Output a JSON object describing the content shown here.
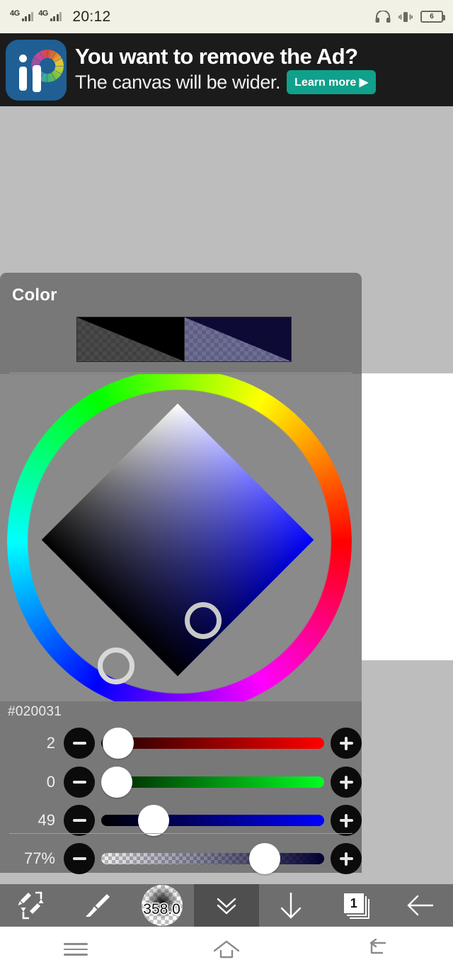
{
  "status_bar": {
    "network_1": "4G",
    "network_2": "4G",
    "time": "20:12",
    "headphones_icon": "headphones-icon",
    "vibrate_icon": "vibrate-icon",
    "battery_level": "6"
  },
  "ad": {
    "headline": "You want to remove the Ad?",
    "subline": "The canvas will be wider.",
    "cta_label": "Learn more ▶",
    "logo_name": "ibis-paint-logo",
    "background_color": "#1b1b1b",
    "cta_color": "#10a08b"
  },
  "color_panel": {
    "title": "Color",
    "previous_swatch_color": "#000000",
    "current_swatch_color": "#020031",
    "next_top_label": "›",
    "next_bottom_label": "›",
    "hex_value": "#020031",
    "sliders": [
      {
        "name": "red",
        "value": "2",
        "percent": 0.8,
        "track": "red-gradient"
      },
      {
        "name": "green",
        "value": "0",
        "percent": 0.0,
        "track": "green-gradient"
      },
      {
        "name": "blue",
        "value": "49",
        "percent": 19.2,
        "track": "blue-gradient"
      },
      {
        "name": "alpha",
        "value": "77%",
        "percent": 77.0,
        "track": "alpha-checkerboard"
      }
    ],
    "minus_label": "−",
    "plus_label": "+"
  },
  "toolbar": {
    "swap_tool": "brush-eraser-swap-icon",
    "brush_tool": "brush-icon",
    "brush_size": "358.0",
    "collapse": "chevron-double-down-icon",
    "download": "arrow-down-icon",
    "layers_count": "1",
    "back": "arrow-left-icon"
  },
  "nav_bar": {
    "recents": "recents-icon",
    "home": "home-icon",
    "back": "back-icon"
  }
}
